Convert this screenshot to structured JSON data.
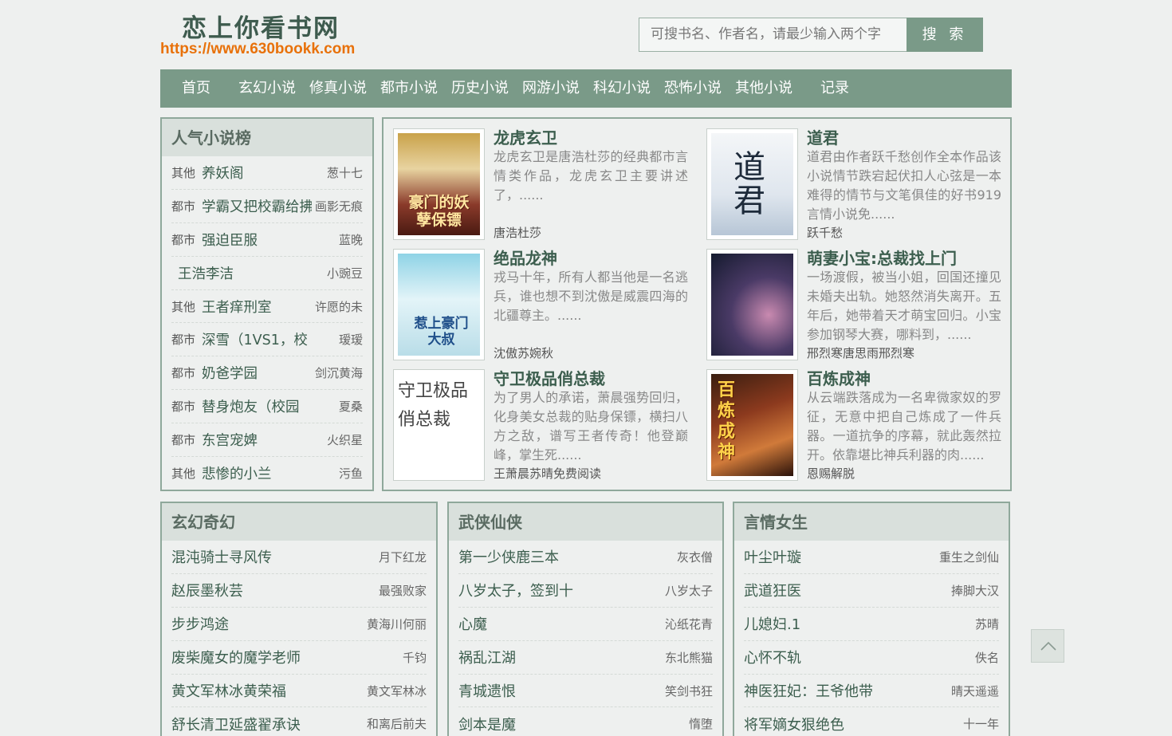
{
  "header": {
    "site_title": "恋上你看书网",
    "site_url": "https://www.630bookk.com",
    "search_placeholder": "可搜书名、作者名，请最少输入两个字",
    "search_button": "搜 索"
  },
  "nav": {
    "items": [
      "首页",
      "玄幻小说",
      "修真小说",
      "都市小说",
      "历史小说",
      "网游小说",
      "科幻小说",
      "恐怖小说",
      "其他小说",
      "记录"
    ]
  },
  "popular": {
    "title": "人气小说榜",
    "items": [
      {
        "cat": "其他",
        "title": "养妖阁",
        "author": "葱十七"
      },
      {
        "cat": "都市",
        "title": "学霸又把校霸给拂",
        "author": "画影无痕"
      },
      {
        "cat": "都市",
        "title": "强迫臣服",
        "author": "蓝晚"
      },
      {
        "cat": "",
        "title": "王浩李洁",
        "author": "小豌豆"
      },
      {
        "cat": "其他",
        "title": "王者痒刑室",
        "author": "许愿的未"
      },
      {
        "cat": "都市",
        "title": "深雪（1VS1，校",
        "author": "瑷瑷"
      },
      {
        "cat": "都市",
        "title": "奶爸学园",
        "author": "剑沉黄海"
      },
      {
        "cat": "都市",
        "title": "替身炮友（校园",
        "author": "夏桑"
      },
      {
        "cat": "都市",
        "title": "东宫宠婢",
        "author": "火织星"
      },
      {
        "cat": "其他",
        "title": "悲惨的小兰",
        "author": "污鱼"
      }
    ]
  },
  "featured": [
    {
      "title": "龙虎玄卫",
      "desc": "龙虎玄卫是唐浩杜莎的经典都市言情类作品，龙虎玄卫主要讲述了，......",
      "author": "唐浩杜莎",
      "cover_text": "豪门的妖孽保镖"
    },
    {
      "title": "道君",
      "desc": "道君由作者跃千愁创作全本作品该小说情节跌宕起伏扣人心弦是一本难得的情节与文笔俱佳的好书919言情小说免......",
      "author": "跃千愁",
      "cover_text": "道君"
    },
    {
      "title": "绝品龙神",
      "desc": "戎马十年，所有人都当他是一名逃兵，谁也想不到沈傲是威震四海的北疆尊主。......",
      "author": "沈傲苏婉秋",
      "cover_text": "惹上豪门大叔"
    },
    {
      "title": "萌妻小宝:总裁找上门",
      "desc": "一场渡假，被当小姐，回国还撞见未婚夫出轨。她怒然消失离开。五年后，她带着天才萌宝回归。小宝参加钢琴大赛，哪料到，......",
      "author": "邢烈寒唐思雨邢烈寒",
      "cover_text": ""
    },
    {
      "title": "守卫极品俏总裁",
      "desc": "为了男人的承诺，萧晨强势回归，化身美女总裁的贴身保镖，横扫八方之敌，谱写王者传奇！他登巅峰，掌生死......",
      "author": "王萧晨苏晴免费阅读",
      "cover_text": "守卫极品俏总裁"
    },
    {
      "title": "百炼成神",
      "desc": "从云端跌落成为一名卑微家奴的罗征，无意中把自己炼成了一件兵器。一道抗争的序幕，就此轰然拉开。依靠堪比神兵利器的肉......",
      "author": "恩赐解脱",
      "cover_text": "百炼成神"
    }
  ],
  "sections": [
    {
      "title": "玄幻奇幻",
      "items": [
        {
          "title": "混沌骑士寻风传",
          "author": "月下红龙"
        },
        {
          "title": "赵辰墨秋芸",
          "author": "最强败家"
        },
        {
          "title": "步步鸿途",
          "author": "黄海川何丽"
        },
        {
          "title": "废柴魔女的魔学老师",
          "author": "千钧"
        },
        {
          "title": "黄文军林冰黄荣福",
          "author": "黄文军林冰"
        },
        {
          "title": "舒长清卫延盛翟承诀",
          "author": "和离后前夫"
        }
      ]
    },
    {
      "title": "武侠仙侠",
      "items": [
        {
          "title": "第一少侠鹿三本",
          "author": "灰衣僧"
        },
        {
          "title": "八岁太子，签到十",
          "author": "八岁太子"
        },
        {
          "title": "心魔",
          "author": "沁纸花青"
        },
        {
          "title": "祸乱江湖",
          "author": "东北熊猫"
        },
        {
          "title": "青城遗恨",
          "author": "笑剑书狂"
        },
        {
          "title": "剑本是魔",
          "author": "惰堕"
        }
      ]
    },
    {
      "title": "言情女生",
      "items": [
        {
          "title": "叶尘叶璇",
          "author": "重生之剑仙"
        },
        {
          "title": "武道狂医",
          "author": "捧脚大汉"
        },
        {
          "title": "儿媳妇.1",
          "author": "苏晴"
        },
        {
          "title": "心怀不轨",
          "author": "佚名"
        },
        {
          "title": "神医狂妃：王爷他带",
          "author": "晴天遥遥"
        },
        {
          "title": "将军嫡女狠绝色",
          "author": "十一年"
        }
      ]
    }
  ],
  "colors": {
    "accent": "#7a9a88",
    "link": "#3c5e4e",
    "url": "#e8710a"
  }
}
